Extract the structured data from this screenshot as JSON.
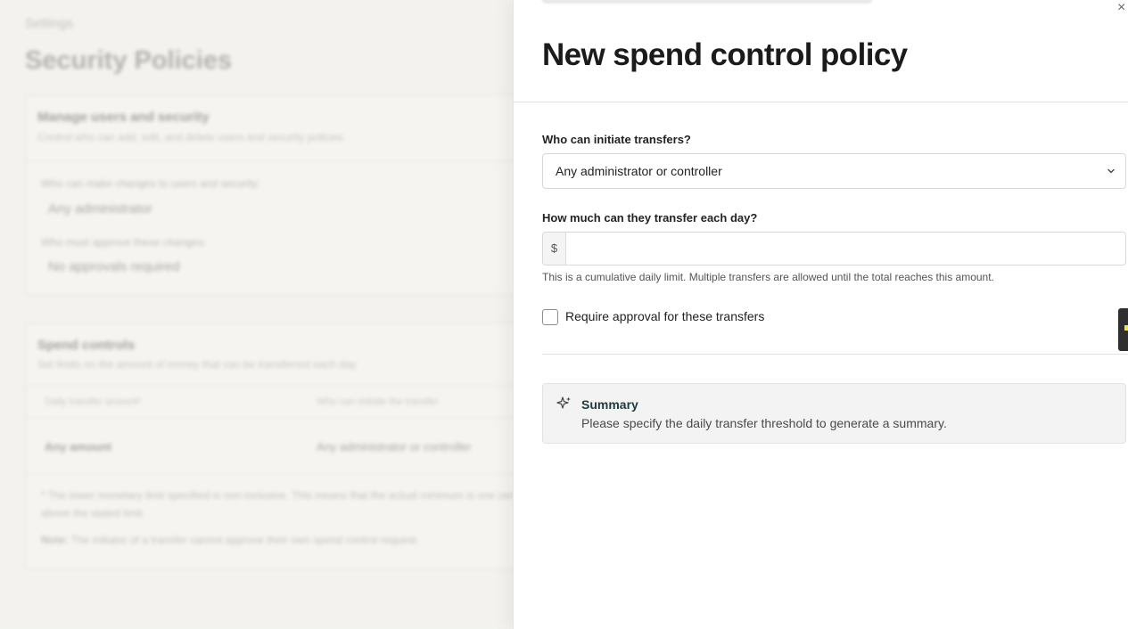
{
  "background": {
    "breadcrumb": "Settings",
    "page_title": "Security Policies",
    "users_card": {
      "title": "Manage users and security",
      "subtitle": "Control who can add, edit, and delete users and security policies",
      "change_label": "Who can make changes to users and security:",
      "change_value": "Any administrator",
      "approve_label": "Who must approve these changes:",
      "approve_value": "No approvals required"
    },
    "spend_card": {
      "title": "Spend controls",
      "subtitle": "Set limits on the amount of money that can be transferred each day",
      "columns": [
        "Daily transfer amount*",
        "Who can initiate the transfer"
      ],
      "row": [
        "Any amount",
        "Any administrator or controller"
      ],
      "footnote": "* The lower monetary limit specified is non-inclusive. This means that the actual minimum is one cent above the stated limit.",
      "note_label": "Note:",
      "note_text": "The initiator of a transfer cannot approve their own spend control request."
    }
  },
  "drawer": {
    "close_glyph": "×",
    "title": "New spend control policy",
    "initiator": {
      "label": "Who can initiate transfers?",
      "value": "Any administrator or controller"
    },
    "amount": {
      "label": "How much can they transfer each day?",
      "currency_prefix": "$",
      "value": "",
      "hint": "This is a cumulative daily limit. Multiple transfers are allowed until the total reaches this amount."
    },
    "approval_checkbox": {
      "label": "Require approval for these transfers",
      "checked": false
    },
    "summary": {
      "icon": "sparkle-icon",
      "title": "Summary",
      "text": "Please specify the daily transfer threshold to generate a summary."
    }
  },
  "colors": {
    "backdrop": "#f2f1ee",
    "drawer_bg": "#ffffff",
    "summary_bg": "#f3f3f3",
    "side_tab": "#2f2f2f",
    "side_tab_accent": "#f3e641"
  }
}
